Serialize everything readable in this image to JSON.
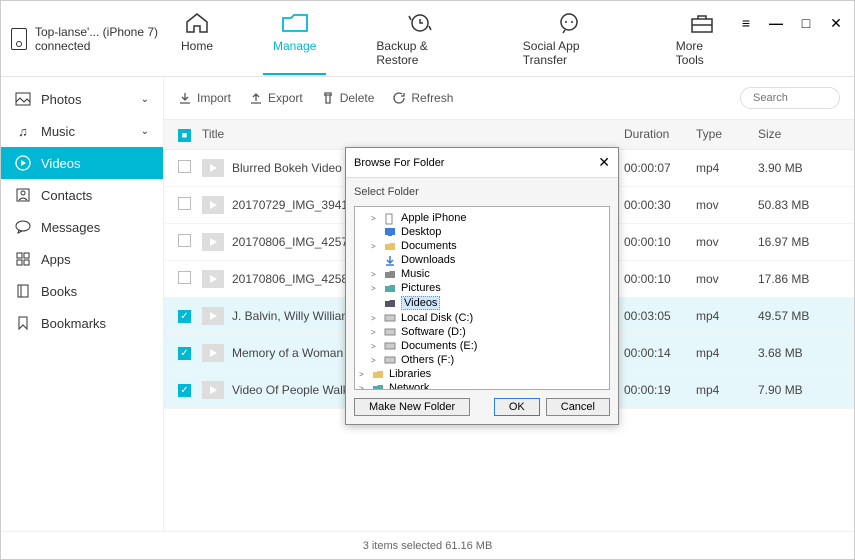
{
  "device": {
    "name": "Top-lanse'... (iPhone 7)",
    "status": "connected"
  },
  "nav": {
    "home": "Home",
    "manage": "Manage",
    "backup": "Backup & Restore",
    "social": "Social App Transfer",
    "more": "More Tools"
  },
  "sidebar": {
    "photos": "Photos",
    "music": "Music",
    "videos": "Videos",
    "contacts": "Contacts",
    "messages": "Messages",
    "apps": "Apps",
    "books": "Books",
    "bookmarks": "Bookmarks"
  },
  "toolbar": {
    "import": "Import",
    "export": "Export",
    "delete": "Delete",
    "refresh": "Refresh",
    "search_placeholder": "Search"
  },
  "table": {
    "headers": {
      "title": "Title",
      "duration": "Duration",
      "type": "Type",
      "size": "Size"
    },
    "rows": [
      {
        "checked": false,
        "title": "Blurred Bokeh Video",
        "duration": "00:00:07",
        "type": "mp4",
        "size": "3.90 MB"
      },
      {
        "checked": false,
        "title": "20170729_IMG_3941",
        "duration": "00:00:30",
        "type": "mov",
        "size": "50.83 MB"
      },
      {
        "checked": false,
        "title": "20170806_IMG_4257",
        "duration": "00:00:10",
        "type": "mov",
        "size": "16.97 MB"
      },
      {
        "checked": false,
        "title": "20170806_IMG_4258",
        "duration": "00:00:10",
        "type": "mov",
        "size": "17.86 MB"
      },
      {
        "checked": true,
        "title": "J. Balvin, Willy William -",
        "duration": "00:03:05",
        "type": "mp4",
        "size": "49.57 MB"
      },
      {
        "checked": true,
        "title": "Memory of a Woman",
        "duration": "00:00:14",
        "type": "mp4",
        "size": "3.68 MB"
      },
      {
        "checked": true,
        "title": "Video Of People Walkin",
        "duration": "00:00:19",
        "type": "mp4",
        "size": "7.90 MB"
      }
    ]
  },
  "footer": "3 items selected 61.16 MB",
  "dialog": {
    "title": "Browse For Folder",
    "subtitle": "Select Folder",
    "make_new": "Make New Folder",
    "ok": "OK",
    "cancel": "Cancel",
    "tree": [
      {
        "indent": 1,
        "exp": ">",
        "icon": "phone",
        "label": "Apple iPhone"
      },
      {
        "indent": 1,
        "exp": "",
        "icon": "desktop",
        "label": "Desktop"
      },
      {
        "indent": 1,
        "exp": ">",
        "icon": "folder",
        "label": "Documents"
      },
      {
        "indent": 1,
        "exp": "",
        "icon": "download",
        "label": "Downloads"
      },
      {
        "indent": 1,
        "exp": ">",
        "icon": "music",
        "label": "Music"
      },
      {
        "indent": 1,
        "exp": ">",
        "icon": "pictures",
        "label": "Pictures"
      },
      {
        "indent": 1,
        "exp": "",
        "icon": "videos",
        "label": "Videos",
        "selected": true
      },
      {
        "indent": 1,
        "exp": ">",
        "icon": "disk",
        "label": "Local Disk (C:)"
      },
      {
        "indent": 1,
        "exp": ">",
        "icon": "disk",
        "label": "Software (D:)"
      },
      {
        "indent": 1,
        "exp": ">",
        "icon": "disk",
        "label": "Documents (E:)"
      },
      {
        "indent": 1,
        "exp": ">",
        "icon": "disk",
        "label": "Others (F:)"
      },
      {
        "indent": 0,
        "exp": ">",
        "icon": "lib",
        "label": "Libraries"
      },
      {
        "indent": 0,
        "exp": ">",
        "icon": "net",
        "label": "Network"
      }
    ]
  }
}
